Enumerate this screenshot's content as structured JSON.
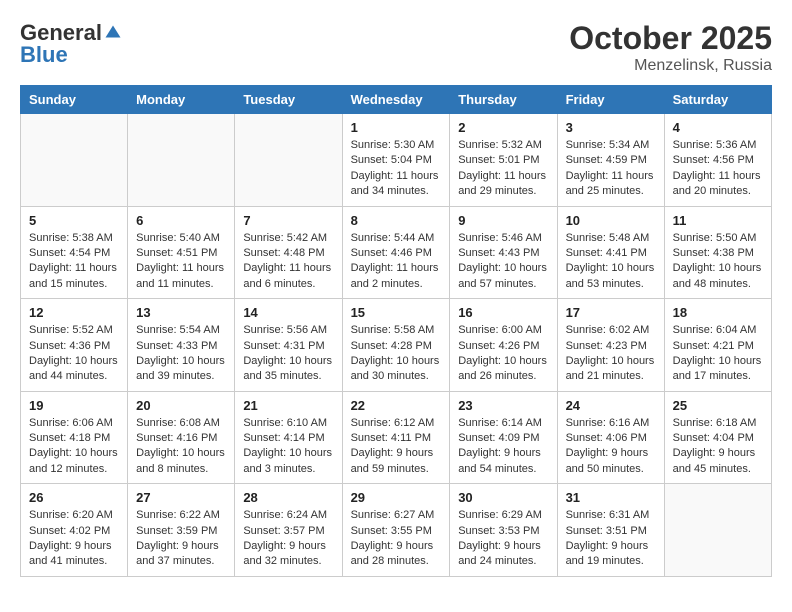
{
  "logo": {
    "general": "General",
    "blue": "Blue"
  },
  "title": {
    "month": "October 2025",
    "location": "Menzelinsk, Russia"
  },
  "weekdays": [
    "Sunday",
    "Monday",
    "Tuesday",
    "Wednesday",
    "Thursday",
    "Friday",
    "Saturday"
  ],
  "weeks": [
    [
      {
        "day": "",
        "info": ""
      },
      {
        "day": "",
        "info": ""
      },
      {
        "day": "",
        "info": ""
      },
      {
        "day": "1",
        "info": "Sunrise: 5:30 AM\nSunset: 5:04 PM\nDaylight: 11 hours\nand 34 minutes."
      },
      {
        "day": "2",
        "info": "Sunrise: 5:32 AM\nSunset: 5:01 PM\nDaylight: 11 hours\nand 29 minutes."
      },
      {
        "day": "3",
        "info": "Sunrise: 5:34 AM\nSunset: 4:59 PM\nDaylight: 11 hours\nand 25 minutes."
      },
      {
        "day": "4",
        "info": "Sunrise: 5:36 AM\nSunset: 4:56 PM\nDaylight: 11 hours\nand 20 minutes."
      }
    ],
    [
      {
        "day": "5",
        "info": "Sunrise: 5:38 AM\nSunset: 4:54 PM\nDaylight: 11 hours\nand 15 minutes."
      },
      {
        "day": "6",
        "info": "Sunrise: 5:40 AM\nSunset: 4:51 PM\nDaylight: 11 hours\nand 11 minutes."
      },
      {
        "day": "7",
        "info": "Sunrise: 5:42 AM\nSunset: 4:48 PM\nDaylight: 11 hours\nand 6 minutes."
      },
      {
        "day": "8",
        "info": "Sunrise: 5:44 AM\nSunset: 4:46 PM\nDaylight: 11 hours\nand 2 minutes."
      },
      {
        "day": "9",
        "info": "Sunrise: 5:46 AM\nSunset: 4:43 PM\nDaylight: 10 hours\nand 57 minutes."
      },
      {
        "day": "10",
        "info": "Sunrise: 5:48 AM\nSunset: 4:41 PM\nDaylight: 10 hours\nand 53 minutes."
      },
      {
        "day": "11",
        "info": "Sunrise: 5:50 AM\nSunset: 4:38 PM\nDaylight: 10 hours\nand 48 minutes."
      }
    ],
    [
      {
        "day": "12",
        "info": "Sunrise: 5:52 AM\nSunset: 4:36 PM\nDaylight: 10 hours\nand 44 minutes."
      },
      {
        "day": "13",
        "info": "Sunrise: 5:54 AM\nSunset: 4:33 PM\nDaylight: 10 hours\nand 39 minutes."
      },
      {
        "day": "14",
        "info": "Sunrise: 5:56 AM\nSunset: 4:31 PM\nDaylight: 10 hours\nand 35 minutes."
      },
      {
        "day": "15",
        "info": "Sunrise: 5:58 AM\nSunset: 4:28 PM\nDaylight: 10 hours\nand 30 minutes."
      },
      {
        "day": "16",
        "info": "Sunrise: 6:00 AM\nSunset: 4:26 PM\nDaylight: 10 hours\nand 26 minutes."
      },
      {
        "day": "17",
        "info": "Sunrise: 6:02 AM\nSunset: 4:23 PM\nDaylight: 10 hours\nand 21 minutes."
      },
      {
        "day": "18",
        "info": "Sunrise: 6:04 AM\nSunset: 4:21 PM\nDaylight: 10 hours\nand 17 minutes."
      }
    ],
    [
      {
        "day": "19",
        "info": "Sunrise: 6:06 AM\nSunset: 4:18 PM\nDaylight: 10 hours\nand 12 minutes."
      },
      {
        "day": "20",
        "info": "Sunrise: 6:08 AM\nSunset: 4:16 PM\nDaylight: 10 hours\nand 8 minutes."
      },
      {
        "day": "21",
        "info": "Sunrise: 6:10 AM\nSunset: 4:14 PM\nDaylight: 10 hours\nand 3 minutes."
      },
      {
        "day": "22",
        "info": "Sunrise: 6:12 AM\nSunset: 4:11 PM\nDaylight: 9 hours\nand 59 minutes."
      },
      {
        "day": "23",
        "info": "Sunrise: 6:14 AM\nSunset: 4:09 PM\nDaylight: 9 hours\nand 54 minutes."
      },
      {
        "day": "24",
        "info": "Sunrise: 6:16 AM\nSunset: 4:06 PM\nDaylight: 9 hours\nand 50 minutes."
      },
      {
        "day": "25",
        "info": "Sunrise: 6:18 AM\nSunset: 4:04 PM\nDaylight: 9 hours\nand 45 minutes."
      }
    ],
    [
      {
        "day": "26",
        "info": "Sunrise: 6:20 AM\nSunset: 4:02 PM\nDaylight: 9 hours\nand 41 minutes."
      },
      {
        "day": "27",
        "info": "Sunrise: 6:22 AM\nSunset: 3:59 PM\nDaylight: 9 hours\nand 37 minutes."
      },
      {
        "day": "28",
        "info": "Sunrise: 6:24 AM\nSunset: 3:57 PM\nDaylight: 9 hours\nand 32 minutes."
      },
      {
        "day": "29",
        "info": "Sunrise: 6:27 AM\nSunset: 3:55 PM\nDaylight: 9 hours\nand 28 minutes."
      },
      {
        "day": "30",
        "info": "Sunrise: 6:29 AM\nSunset: 3:53 PM\nDaylight: 9 hours\nand 24 minutes."
      },
      {
        "day": "31",
        "info": "Sunrise: 6:31 AM\nSunset: 3:51 PM\nDaylight: 9 hours\nand 19 minutes."
      },
      {
        "day": "",
        "info": ""
      }
    ]
  ]
}
